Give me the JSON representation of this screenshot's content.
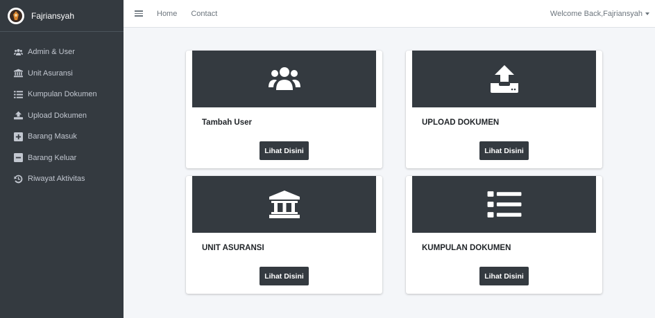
{
  "brand": {
    "name": "Fajriansyah"
  },
  "sidebar": {
    "items": [
      {
        "label": "Admin & User",
        "icon": "users-icon"
      },
      {
        "label": "Unit Asuransi",
        "icon": "university-icon"
      },
      {
        "label": "Kumpulan Dokumen",
        "icon": "list-icon"
      },
      {
        "label": "Upload Dokumen",
        "icon": "upload-icon"
      },
      {
        "label": "Barang Masuk",
        "icon": "plus-square-icon"
      },
      {
        "label": "Barang Keluar",
        "icon": "minus-square-icon"
      },
      {
        "label": "Riwayat Aktivitas",
        "icon": "history-icon"
      }
    ]
  },
  "topbar": {
    "home": "Home",
    "contact": "Contact",
    "welcome": "Welcome Back,Fajriansyah"
  },
  "cards": [
    {
      "title": "Tambah User",
      "button": "Lihat Disini",
      "icon": "users-icon"
    },
    {
      "title": "UPLOAD DOKUMEN",
      "button": "Lihat Disini",
      "icon": "upload-icon"
    },
    {
      "title": "UNIT ASURANSI",
      "button": "Lihat Disini",
      "icon": "university-icon"
    },
    {
      "title": "KUMPULAN DOKUMEN",
      "button": "Lihat Disini",
      "icon": "list-icon"
    }
  ],
  "colors": {
    "sidebar": "#343a40",
    "accent": "#343a40",
    "background": "#f4f6f9"
  }
}
